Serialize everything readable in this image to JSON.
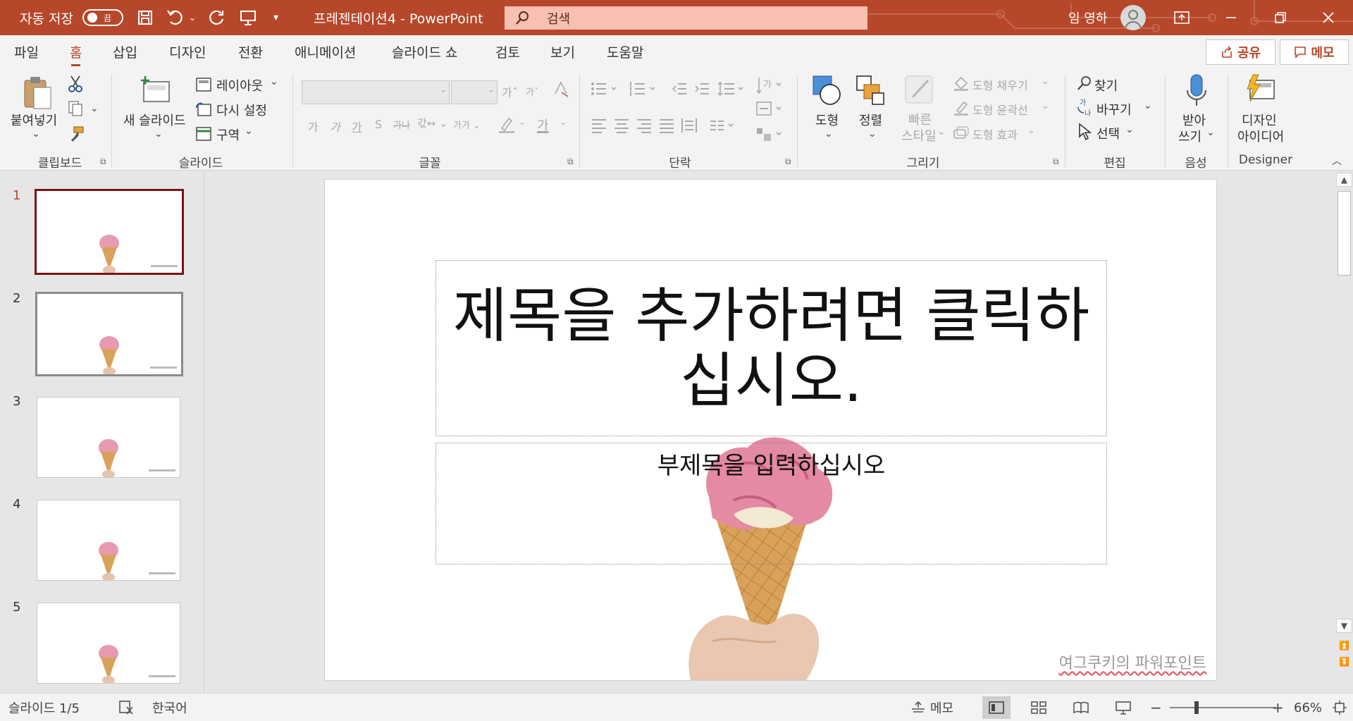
{
  "titlebar": {
    "autosave_label": "자동 저장",
    "autosave_state": "끔",
    "doc_title": "프레젠테이션4  -  PowerPoint",
    "search_placeholder": "검색",
    "user_name": "임 영하"
  },
  "tabs": [
    {
      "label": "파일"
    },
    {
      "label": "홈"
    },
    {
      "label": "삽입"
    },
    {
      "label": "디자인"
    },
    {
      "label": "전환"
    },
    {
      "label": "애니메이션"
    },
    {
      "label": "슬라이드 쇼"
    },
    {
      "label": "검토"
    },
    {
      "label": "보기"
    },
    {
      "label": "도움말"
    }
  ],
  "share_label": "공유",
  "memo_label": "메모",
  "ribbon": {
    "clipboard": {
      "paste": "붙여넣기",
      "group": "클립보드"
    },
    "slides": {
      "new_slide": "새 슬라이드",
      "layout": "레이아웃",
      "reset": "다시 설정",
      "section": "구역",
      "group": "슬라이드"
    },
    "font": {
      "group": "글꼴"
    },
    "paragraph": {
      "group": "단락"
    },
    "drawing": {
      "shapes": "도형",
      "arrange": "정렬",
      "quick_styles_1": "빠른",
      "quick_styles_2": "스타일",
      "fill": "도형 채우기",
      "outline": "도형 윤곽선",
      "effects": "도형 효과",
      "group": "그리기"
    },
    "editing": {
      "find": "찾기",
      "replace": "바꾸기",
      "select": "선택",
      "group": "편집"
    },
    "voice": {
      "dictate_1": "받아",
      "dictate_2": "쓰기",
      "group": "음성"
    },
    "designer": {
      "ideas_1": "디자인",
      "ideas_2": "아이디어",
      "group": "Designer"
    }
  },
  "thumbnails": [
    {
      "num": "1"
    },
    {
      "num": "2"
    },
    {
      "num": "3"
    },
    {
      "num": "4"
    },
    {
      "num": "5"
    }
  ],
  "slide": {
    "title_line1": "제목을 추가하려면 클릭하",
    "title_line2": "십시오.",
    "subtitle": "부제목을 입력하십시오",
    "credit": "여그쿠키의 파워포인트"
  },
  "statusbar": {
    "slide_info": "슬라이드 1/5",
    "language": "한국어",
    "notes": "메모",
    "zoom": "66%"
  },
  "colors": {
    "accent": "#b7472a",
    "ribbon_bg": "#f3f3f3",
    "selected_thumb_border": "#7a1414"
  }
}
